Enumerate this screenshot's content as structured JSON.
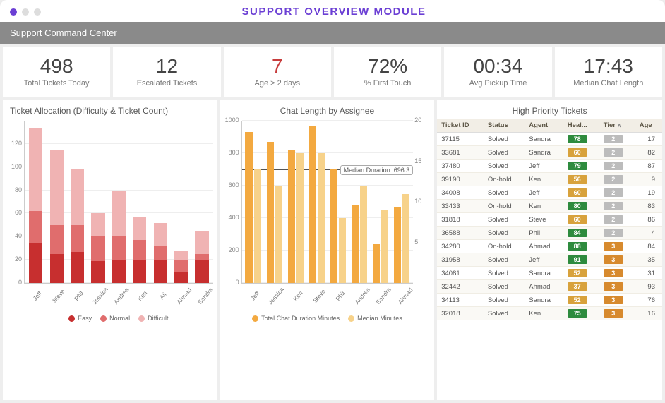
{
  "window": {
    "title": "SUPPORT OVERVIEW MODULE",
    "subtitle": "Support Command Center"
  },
  "kpis": [
    {
      "value": "498",
      "label": "Total Tickets Today",
      "highlight": false
    },
    {
      "value": "12",
      "label": "Escalated Tickets",
      "highlight": false
    },
    {
      "value": "7",
      "label": "Age > 2 days",
      "highlight": true
    },
    {
      "value": "72%",
      "label": "% First Touch",
      "highlight": false
    },
    {
      "value": "00:34",
      "label": "Avg Pickup Time",
      "highlight": false
    },
    {
      "value": "17:43",
      "label": "Median Chat Length",
      "highlight": false
    }
  ],
  "ticket_alloc": {
    "title": "Ticket Allocation (Difficulty & Ticket Count)",
    "legend": [
      "Easy",
      "Normal",
      "Difficult"
    ]
  },
  "chat_chart": {
    "title": "Chat Length by Assignee",
    "legend": [
      "Total Chat Duration Minutes",
      "Median Minutes"
    ],
    "median_label": "Median Duration: 696.3"
  },
  "table": {
    "title": "High Priority Tickets",
    "columns": [
      "Ticket ID",
      "Status",
      "Agent",
      "Heal...",
      "Tier",
      "Age"
    ],
    "rows": [
      {
        "id": "37115",
        "status": "Solved",
        "agent": "Sandra",
        "health": 78,
        "hc": "green",
        "tier": 2,
        "age": 17
      },
      {
        "id": "33681",
        "status": "Solved",
        "agent": "Sandra",
        "health": 60,
        "hc": "orange",
        "tier": 2,
        "age": 82
      },
      {
        "id": "37480",
        "status": "Solved",
        "agent": "Jeff",
        "health": 79,
        "hc": "green",
        "tier": 2,
        "age": 87
      },
      {
        "id": "39190",
        "status": "On-hold",
        "agent": "Ken",
        "health": 56,
        "hc": "orange",
        "tier": 2,
        "age": 9
      },
      {
        "id": "34008",
        "status": "Solved",
        "agent": "Jeff",
        "health": 60,
        "hc": "orange",
        "tier": 2,
        "age": 19
      },
      {
        "id": "33433",
        "status": "On-hold",
        "agent": "Ken",
        "health": 80,
        "hc": "green",
        "tier": 2,
        "age": 83
      },
      {
        "id": "31818",
        "status": "Solved",
        "agent": "Steve",
        "health": 60,
        "hc": "orange",
        "tier": 2,
        "age": 86
      },
      {
        "id": "36588",
        "status": "Solved",
        "agent": "Phil",
        "health": 84,
        "hc": "green",
        "tier": 2,
        "age": 4
      },
      {
        "id": "34280",
        "status": "On-hold",
        "agent": "Ahmad",
        "health": 88,
        "hc": "green",
        "tier": 3,
        "age": 84
      },
      {
        "id": "31958",
        "status": "Solved",
        "agent": "Jeff",
        "health": 91,
        "hc": "green",
        "tier": 3,
        "age": 35
      },
      {
        "id": "34081",
        "status": "Solved",
        "agent": "Sandra",
        "health": 52,
        "hc": "orange",
        "tier": 3,
        "age": 31
      },
      {
        "id": "32442",
        "status": "Solved",
        "agent": "Ahmad",
        "health": 37,
        "hc": "orange",
        "tier": 3,
        "age": 93
      },
      {
        "id": "34113",
        "status": "Solved",
        "agent": "Sandra",
        "health": 52,
        "hc": "orange",
        "tier": 3,
        "age": 76
      },
      {
        "id": "32018",
        "status": "Solved",
        "agent": "Ken",
        "health": 75,
        "hc": "green",
        "tier": 3,
        "age": 16
      }
    ]
  },
  "chart_data": [
    {
      "type": "bar",
      "stacked": true,
      "title": "Ticket Allocation (Difficulty & Ticket Count)",
      "categories": [
        "Jeff",
        "Steve",
        "Phil",
        "Jessica",
        "Andrea",
        "Ken",
        "Ali",
        "Ahmad",
        "Sandra"
      ],
      "series": [
        {
          "name": "Easy",
          "values": [
            35,
            25,
            27,
            19,
            20,
            20,
            20,
            10,
            20
          ],
          "color": "#c72f2f"
        },
        {
          "name": "Normal",
          "values": [
            27,
            25,
            23,
            21,
            20,
            17,
            12,
            10,
            5
          ],
          "color": "#e06d6d"
        },
        {
          "name": "Difficult",
          "values": [
            72,
            65,
            48,
            20,
            40,
            20,
            20,
            8,
            20
          ],
          "color": "#f0b3b3"
        }
      ],
      "ylim": [
        0,
        140
      ],
      "yticks": [
        0,
        20,
        40,
        60,
        80,
        100,
        120
      ]
    },
    {
      "type": "bar",
      "title": "Chat Length by Assignee",
      "categories": [
        "Jeff",
        "Jessica",
        "Ken",
        "Steve",
        "Phil",
        "Andrea",
        "Sandra",
        "Ahmad"
      ],
      "series": [
        {
          "name": "Total Chat Duration Minutes",
          "axis": "left",
          "values": [
            930,
            870,
            820,
            970,
            700,
            480,
            240,
            470
          ],
          "color": "#f3a940"
        },
        {
          "name": "Median Minutes",
          "axis": "right",
          "values": [
            14,
            12,
            16,
            16,
            8,
            12,
            9,
            11
          ],
          "color": "#f7d28a"
        }
      ],
      "ylim_left": [
        0,
        1000
      ],
      "yticks_left": [
        0,
        200,
        400,
        600,
        800,
        1000
      ],
      "ylim_right": [
        0,
        20
      ],
      "yticks_right": [
        5,
        10,
        15,
        20
      ],
      "reference_line": {
        "value": 696.3,
        "label": "Median Duration: 696.3",
        "axis": "left"
      }
    }
  ]
}
